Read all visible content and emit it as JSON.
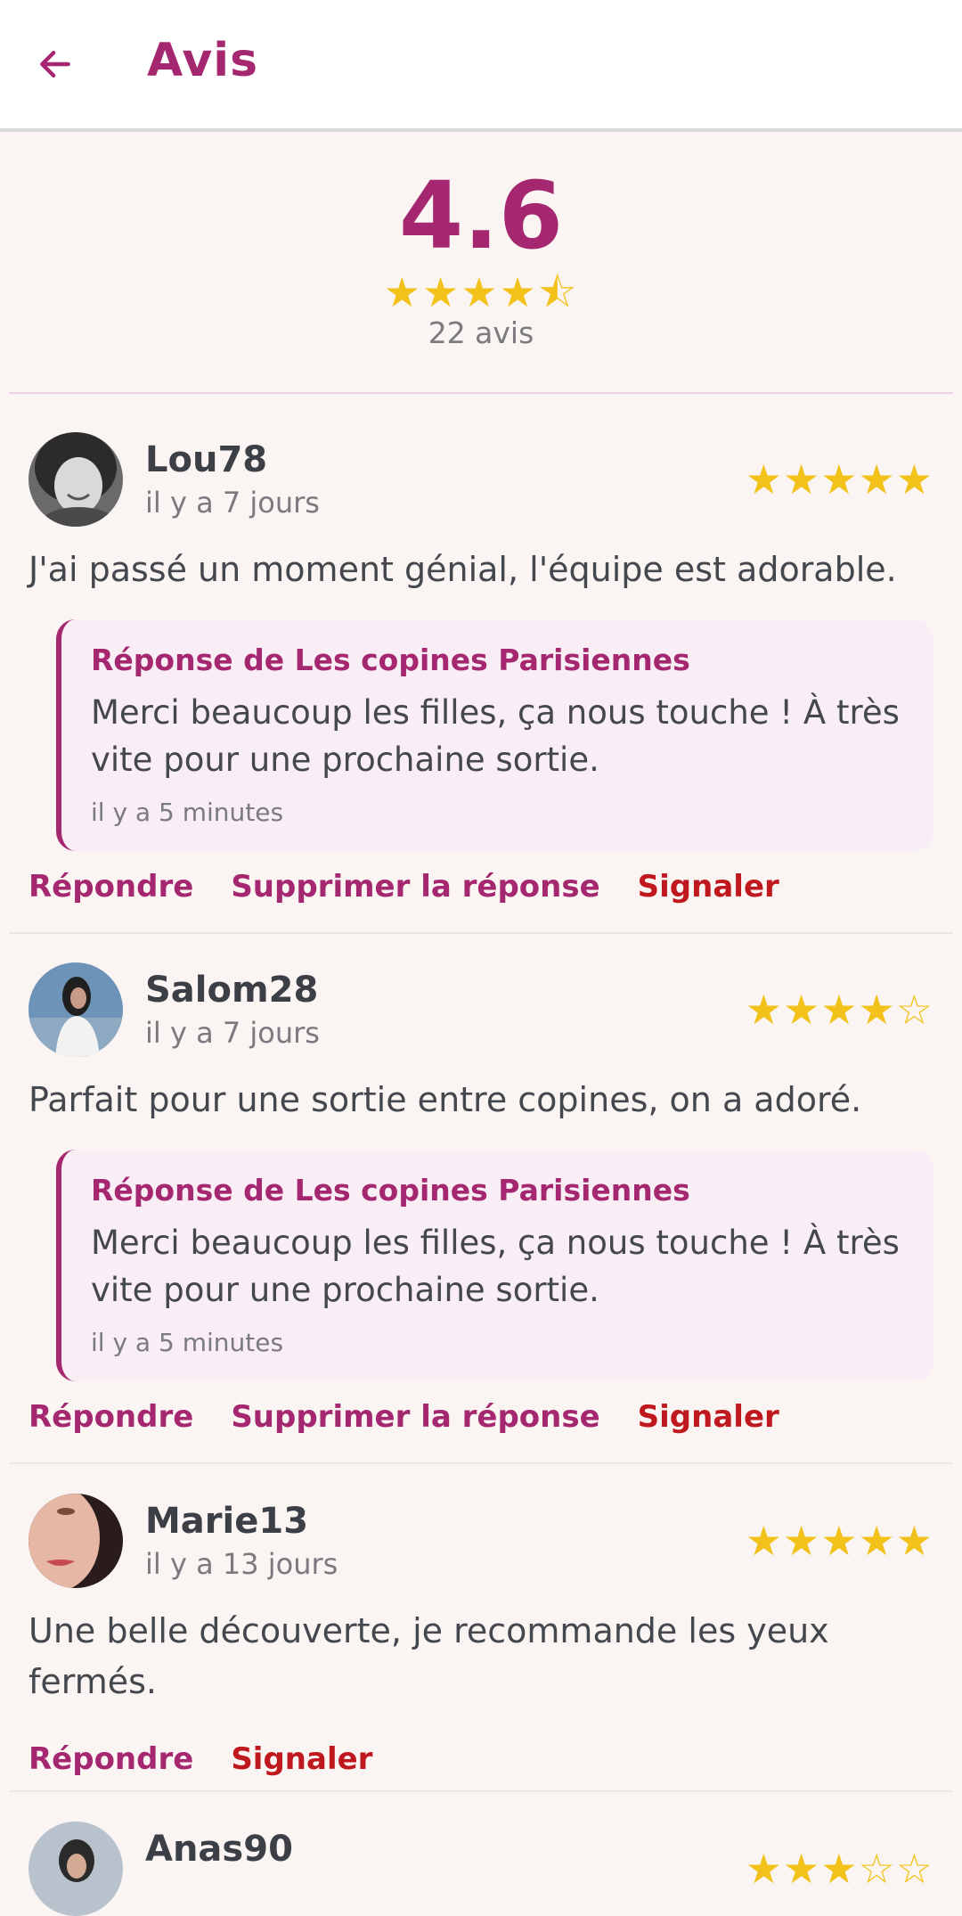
{
  "appbar": {
    "title": "Avis"
  },
  "summary": {
    "rating": "4.6",
    "stars": "★★★★⯪",
    "count_label": "22 avis"
  },
  "reviews": [
    {
      "name": "Lou78",
      "date": "il y a 7 jours",
      "stars": "★★★★★",
      "rating": 5,
      "text": "J'ai passé un moment génial, l'équipe est adorable.",
      "reply": {
        "title": "Réponse de Les copines Parisiennes",
        "text": "Merci beaucoup les filles, ça nous touche ! À très vite pour une prochaine sortie.",
        "date": "il y a 5 minutes"
      },
      "actions": {
        "respond": "Répondre",
        "delete": "Supprimer la réponse",
        "report": "Signaler"
      }
    },
    {
      "name": "Salom28",
      "date": "il y a 7 jours",
      "stars": "★★★★☆",
      "rating": 4,
      "text": "Parfait pour une sortie entre copines, on a adoré.",
      "reply": {
        "title": "Réponse de Les copines Parisiennes",
        "text": "Merci beaucoup les filles, ça nous touche ! À très vite pour une prochaine sortie.",
        "date": "il y a 5 minutes"
      },
      "actions": {
        "respond": "Répondre",
        "delete": "Supprimer la réponse",
        "report": "Signaler"
      }
    },
    {
      "name": "Marie13",
      "date": "il y a 13 jours",
      "stars": "★★★★★",
      "rating": 5,
      "text": "Une belle découverte, je recommande les yeux fermés.",
      "actions": {
        "respond": "Répondre",
        "report": "Signaler"
      }
    },
    {
      "name": "Anas90",
      "stars": "★★★☆☆",
      "rating": 3
    }
  ],
  "colors": {
    "accent": "#a4276f",
    "star": "#f2c21b",
    "report": "#c0181f",
    "background": "#faf5f3",
    "reply_bg": "#faeef6"
  },
  "icons": {
    "back": "arrow-left-icon"
  }
}
